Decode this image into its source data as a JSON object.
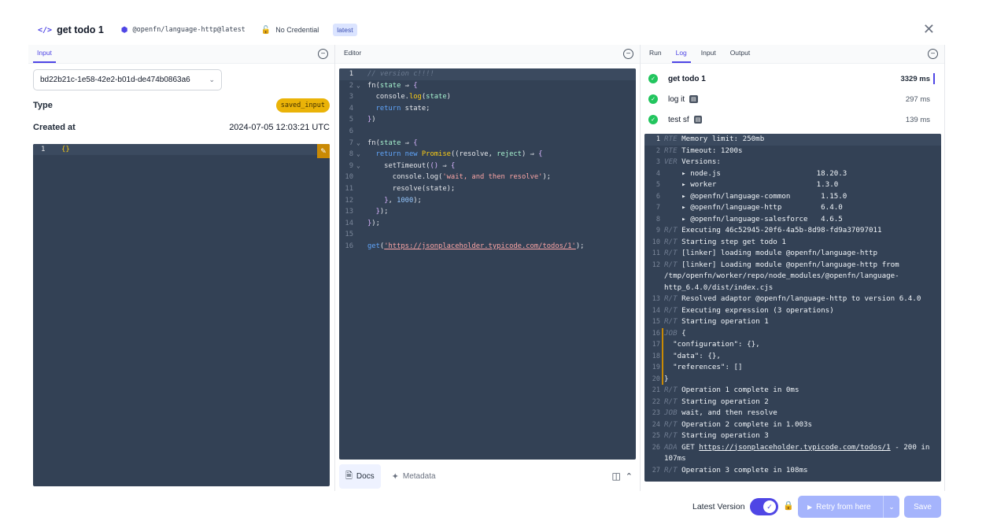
{
  "header": {
    "job_name": "get todo 1",
    "adaptor": "@openfn/language-http@latest",
    "credential": "No Credential",
    "version_badge": "latest",
    "icons": {
      "job": "code-icon",
      "adaptor": "cube-icon",
      "credential": "unlock-icon",
      "close": "close-icon"
    }
  },
  "input_panel": {
    "tab": "Input",
    "dataclip_id": "bd22b21c-1e58-42e2-b01d-de474b0863a6",
    "type_label": "Type",
    "type_value": "saved_input",
    "created_label": "Created at",
    "created_value": "2024-07-05 12:03:21 UTC",
    "editor": {
      "line_number": "1",
      "content": "{}"
    }
  },
  "editor_panel": {
    "title": "Editor",
    "footer": {
      "docs": "Docs",
      "metadata": "Metadata"
    }
  },
  "run_panel": {
    "tabs": [
      "Run",
      "Log",
      "Input",
      "Output"
    ],
    "active_tab": "Log",
    "steps": [
      {
        "name": "get todo 1",
        "time": "3329 ms"
      },
      {
        "name": "log it",
        "time": "297 ms"
      },
      {
        "name": "test sf",
        "time": "139 ms"
      }
    ]
  },
  "footer": {
    "latest_version": "Latest Version",
    "retry": "Retry from here",
    "save": "Save"
  },
  "colors": {
    "accent": "#4f46e5",
    "editor_bg": "#334155",
    "success": "#22c55e",
    "badge_yellow": "#eab308",
    "disabled_button": "#a5b4fc"
  }
}
